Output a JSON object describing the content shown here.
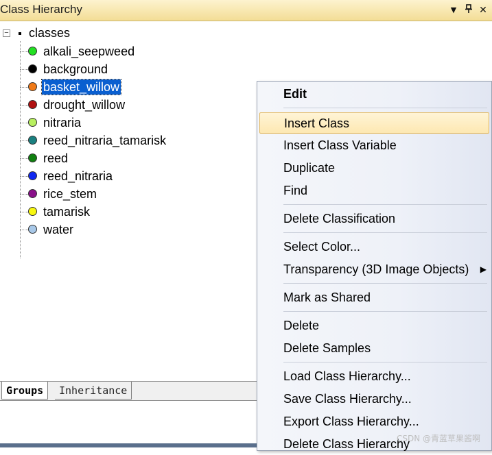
{
  "window": {
    "title": "Class Hierarchy",
    "controls": {
      "dropdown": "▼",
      "pin": "📌",
      "close": "✕"
    }
  },
  "tree": {
    "root_label": "classes",
    "root_toggle": "−",
    "classes": [
      {
        "label": "alkali_seepweed",
        "color": "#22e022"
      },
      {
        "label": "background",
        "color": "#000000"
      },
      {
        "label": "basket_willow",
        "color": "#f07a18",
        "selected": true
      },
      {
        "label": "drought_willow",
        "color": "#b01010"
      },
      {
        "label": "nitraria",
        "color": "#b8f060"
      },
      {
        "label": "reed_nitraria_tamarisk",
        "color": "#1a8080"
      },
      {
        "label": "reed",
        "color": "#108010"
      },
      {
        "label": "reed_nitraria",
        "color": "#1028f0"
      },
      {
        "label": "rice_stem",
        "color": "#8a108a"
      },
      {
        "label": "tamarisk",
        "color": "#f8f810"
      },
      {
        "label": "water",
        "color": "#a8c8e8"
      }
    ]
  },
  "tabs": [
    {
      "label": "Groups",
      "active": true
    },
    {
      "label": "Inheritance",
      "active": false
    }
  ],
  "context_menu": {
    "header": "Edit",
    "items": [
      "Insert Class",
      "Insert Class Variable",
      "Duplicate",
      "Find",
      "Delete Classification",
      "Select Color...",
      "Transparency (3D Image Objects)",
      "Mark as Shared",
      "Delete",
      "Delete Samples",
      "Load Class Hierarchy...",
      "Save Class Hierarchy...",
      "Export Class Hierarchy...",
      "Delete Class Hierarchy"
    ],
    "highlighted": "Insert Class",
    "submenu_arrow": "▶"
  },
  "watermark": "CSDN @青蓝草果酱啊",
  "colors": {
    "titlebar": "#f3dd95",
    "selection": "#0a5fd0",
    "menu_highlight": "#fde8b2"
  }
}
